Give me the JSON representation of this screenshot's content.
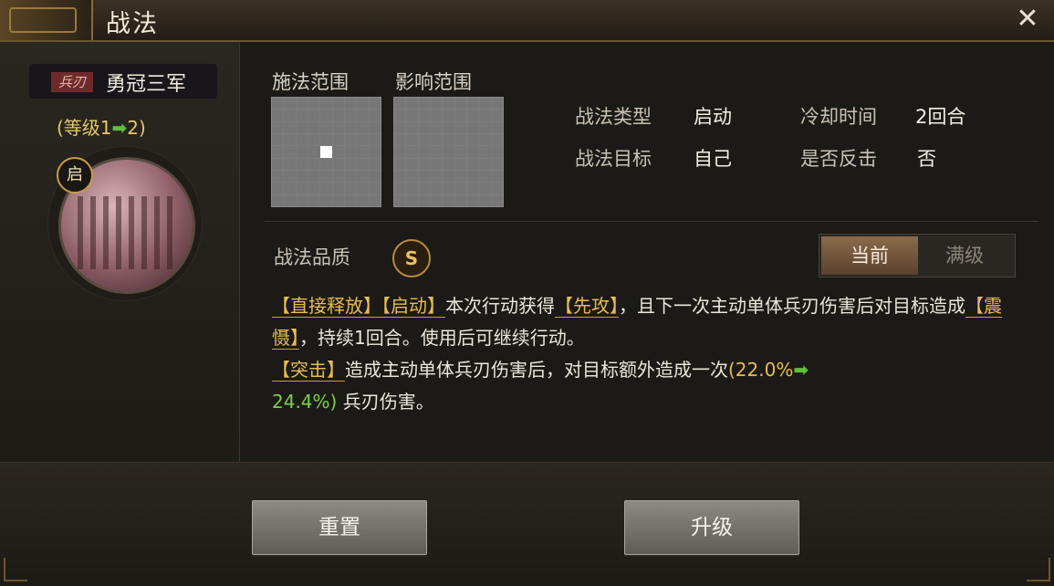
{
  "title": "战法",
  "close_icon": "close-icon",
  "skill": {
    "type_tag": "兵刃",
    "name": "勇冠三军",
    "level_text_prefix": "(等级1",
    "level_arrow": "➡",
    "level_text_suffix": "2)",
    "activate_badge": "启"
  },
  "range": {
    "cast_label": "施法范围",
    "effect_label": "影响范围"
  },
  "info": {
    "type_label": "战法类型",
    "type_value": "启动",
    "cooldown_label": "冷却时间",
    "cooldown_value": "2回合",
    "target_label": "战法目标",
    "target_value": "自己",
    "counter_label": "是否反击",
    "counter_value": "否"
  },
  "quality": {
    "label": "战法品质",
    "grade": "S"
  },
  "toggle": {
    "current": "当前",
    "max": "满级"
  },
  "description": {
    "kw1": "【直接释放】",
    "kw2": "【启动】",
    "t1": "本次行动获得",
    "kw3": "【先攻】",
    "t2": "，且下一次主动单体兵刃伤害后对目标造成",
    "kw4": "【震慑】",
    "t3": "，持续1回合。使用后可继续行动。",
    "kw5": "【突击】",
    "t4": "造成主动单体兵刃伤害后，对目标额外造成一次",
    "num_old": "(22.0%",
    "arrow": "➡",
    "num_new": "24.4%)",
    "t5": "兵刃伤害。"
  },
  "buttons": {
    "reset": "重置",
    "upgrade": "升级"
  }
}
